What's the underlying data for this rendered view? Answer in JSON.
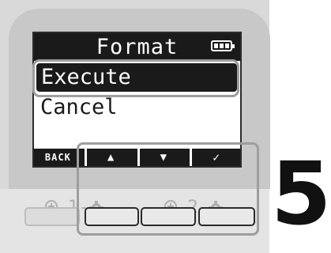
{
  "screen": {
    "title": "Format",
    "menu": {
      "selected": "Execute",
      "other": "Cancel"
    },
    "softkeys": {
      "back_label": "BACK",
      "up_glyph": "▲",
      "down_glyph": "▼",
      "confirm_glyph": "✓"
    }
  },
  "tracks": [
    {
      "number": "1"
    },
    {
      "number": "2"
    }
  ],
  "step_number": "5",
  "colors": {
    "screen_dark": "#1a1a1a",
    "highlight": "#9e9e9e",
    "device": "#d9d9d9"
  }
}
